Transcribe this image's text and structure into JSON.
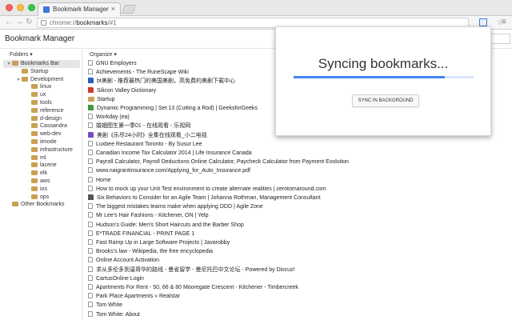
{
  "browser": {
    "tab_title": "Bookmark Manager",
    "tab_close": "×",
    "url_prefix": "chrome://",
    "url_host": "bookmarks",
    "url_suffix": "/#1",
    "star_glyph": "☆",
    "menu_glyph": "≡",
    "back_glyph": "←",
    "forward_glyph": "→",
    "reload_glyph": "↻"
  },
  "page": {
    "title": "Bookmark Manager",
    "folders_label": "Folders ▾",
    "organize_label": "Organize ▾"
  },
  "tree": [
    {
      "label": "Bookmarks Bar",
      "expand": "▾"
    },
    {
      "label": "Startup",
      "expand": ""
    },
    {
      "label": "Development",
      "expand": "▾"
    },
    {
      "label": "linux",
      "expand": ""
    },
    {
      "label": "ux",
      "expand": ""
    },
    {
      "label": "tools",
      "expand": ""
    },
    {
      "label": "reference",
      "expand": ""
    },
    {
      "label": "d-design",
      "expand": ""
    },
    {
      "label": "Cassandra",
      "expand": ""
    },
    {
      "label": "web-dev",
      "expand": ""
    },
    {
      "label": "iimode",
      "expand": ""
    },
    {
      "label": "infrastructure",
      "expand": ""
    },
    {
      "label": "ml",
      "expand": ""
    },
    {
      "label": "lacene",
      "expand": ""
    },
    {
      "label": "elk",
      "expand": ""
    },
    {
      "label": "aws",
      "expand": ""
    },
    {
      "label": "ios",
      "expand": ""
    },
    {
      "label": "ops",
      "expand": ""
    },
    {
      "label": "Other Bookmarks",
      "expand": ""
    }
  ],
  "bookmarks": [
    {
      "title": "GNU Employers",
      "icon": "page"
    },
    {
      "title": "Achievements - The RuneScape Wiki",
      "icon": "page"
    },
    {
      "title": "bt美剧 - 推荐最热门的美国美剧，高免费的美剧下载中心",
      "icon": "blue"
    },
    {
      "title": "Silicon Valley Dictionary",
      "icon": "red"
    },
    {
      "title": "Startup",
      "icon": "folder"
    },
    {
      "title": "Dynamic Programming | Set 13 (Cutting a Rod) | GeeksforGeeks",
      "icon": "green"
    },
    {
      "title": "Workday (ea)",
      "icon": "page"
    },
    {
      "title": "婚姻图生第一季01 - 在线观看 - 乐视网",
      "icon": "page"
    },
    {
      "title": "美剧《乐尽24小时》全集在线观看_小二电视",
      "icon": "purple"
    },
    {
      "title": "Luxbee Restaurant Toronto - By Susur Lee",
      "icon": "page"
    },
    {
      "title": "Canadian Income Tax Calculator 2014 | Life Insurance Canada",
      "icon": "page"
    },
    {
      "title": "Payroll Calculator, Payroll Deductions Online Calculator, Paycheck Calculator from Payment Evolution",
      "icon": "page"
    },
    {
      "title": "www.naigrantinsurance.com/Applying_for_Auto_Insurance.pdf",
      "icon": "page"
    },
    {
      "title": "Home",
      "icon": "page"
    },
    {
      "title": "How to mock up your Unit Test environment to create alternate realities | zerotomaround.com",
      "icon": "page"
    },
    {
      "title": "Six Behaviors to Consider for an Agile Team | Johanna Rothman, Management Consultant",
      "icon": "grid"
    },
    {
      "title": "The biggest mistakes teams make when applying DDD | Agile Zone",
      "icon": "page"
    },
    {
      "title": "Mr Lee's Hair Fashions - Kitchener, ON | Yelp",
      "icon": "page"
    },
    {
      "title": "Hudson's Guide: Men's Short Haircuts and the Barber Shop",
      "icon": "page"
    },
    {
      "title": "E*TRADE FINANCIAL - PRINT PAGE 1",
      "icon": "page"
    },
    {
      "title": "Fast Ramp Up in Large Software Projects | Javarobby",
      "icon": "page"
    },
    {
      "title": "Brooks's law - Wikipedia, the free encyclopedia",
      "icon": "page"
    },
    {
      "title": "Online Account Activation",
      "icon": "page"
    },
    {
      "title": "求从多伦多到温哥华的路线 - 曼省留学 - 曼尼托巴中文论坛 - Powered by Discuz!",
      "icon": "page"
    },
    {
      "title": "CartusOnline Login",
      "icon": "page"
    },
    {
      "title": "Apartments For Rent - 50, 66 & 80 Mooregate Crescent - Kitchener - Timbercreek",
      "icon": "page"
    },
    {
      "title": "Park Place Apartments » Realstar",
      "icon": "page"
    },
    {
      "title": "Tom White",
      "icon": "page"
    },
    {
      "title": "Tom White: About",
      "icon": "page"
    }
  ],
  "dialog": {
    "title": "Syncing bookmarks...",
    "progress_fraction": 0.84,
    "button_label": "SYNC IN BACKGROUND"
  },
  "colors": {
    "accent": "#4285f4",
    "folder": "#c9a055"
  }
}
